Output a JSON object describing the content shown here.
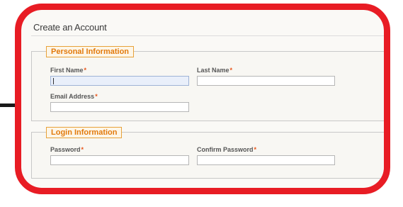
{
  "page": {
    "title": "Create an Account"
  },
  "personal_info": {
    "legend": "Personal Information",
    "first_name": {
      "label": "First Name",
      "required_mark": "*",
      "value": ""
    },
    "last_name": {
      "label": "Last Name",
      "required_mark": "*",
      "value": ""
    },
    "email": {
      "label": "Email Address",
      "required_mark": "*",
      "value": ""
    }
  },
  "login_info": {
    "legend": "Login Information",
    "password": {
      "label": "Password",
      "required_mark": "*",
      "value": ""
    },
    "confirm_password": {
      "label": "Confirm Password",
      "required_mark": "*",
      "value": ""
    }
  },
  "colors": {
    "frame": "#e81c24",
    "legend_text": "#e27a0d",
    "required_mark": "#e8551a",
    "focused_input": "#e9effa"
  }
}
